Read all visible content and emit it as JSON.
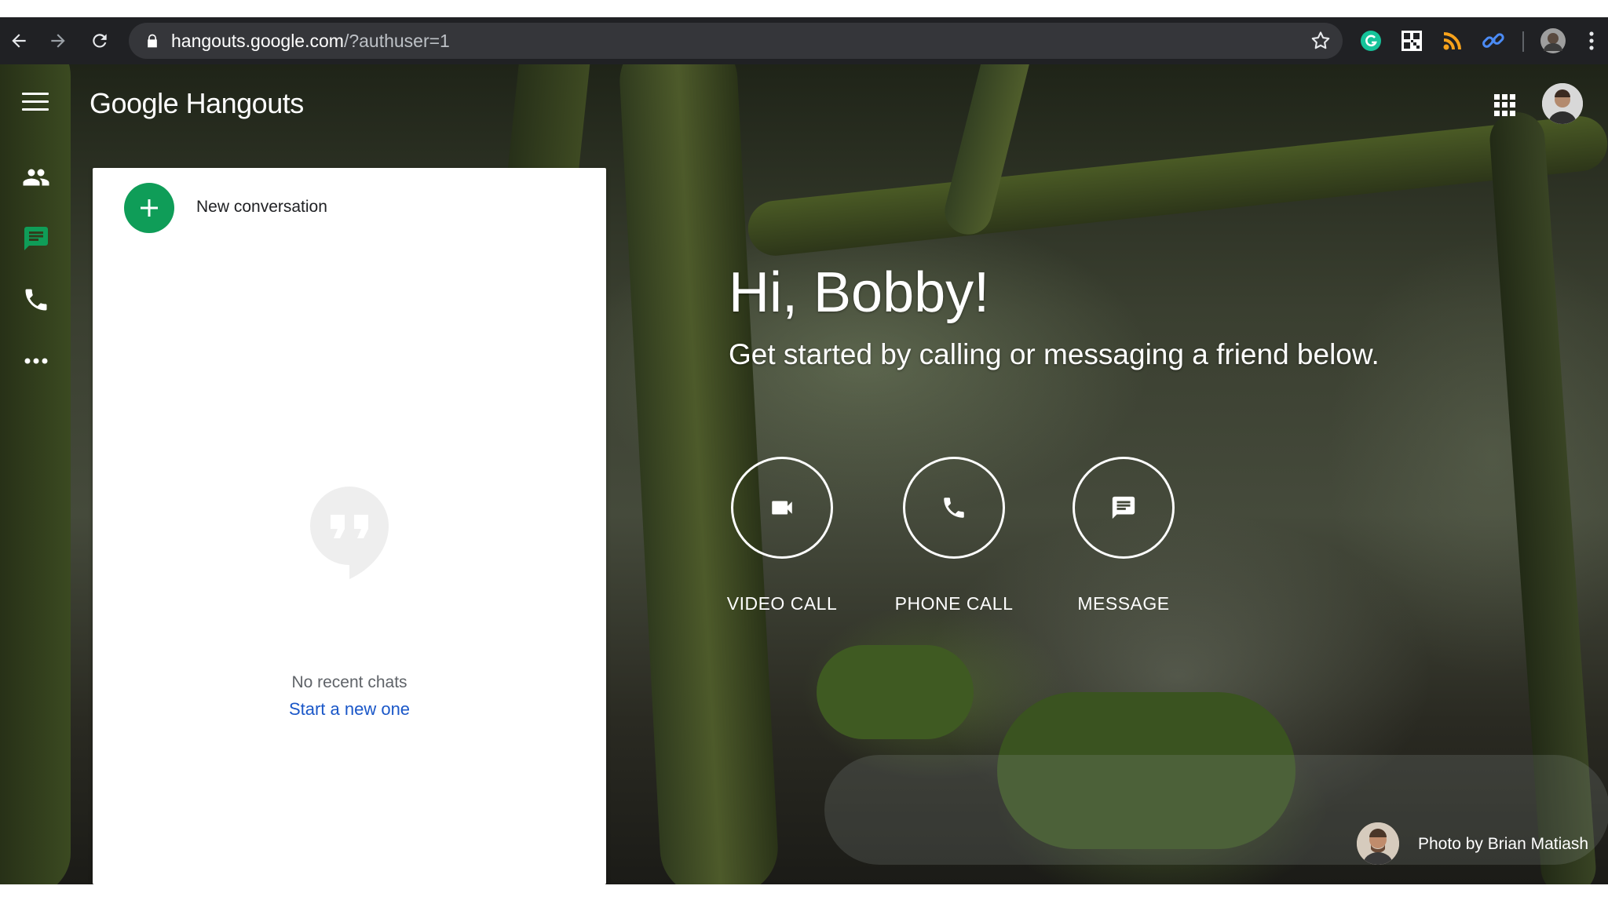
{
  "browser": {
    "url_domain": "hangouts.google.com",
    "url_path": "/?authuser=1",
    "icons": [
      "back-arrow-icon",
      "forward-arrow-icon",
      "reload-icon",
      "lock-icon",
      "bookmark-star-icon",
      "grammarly-extension-icon",
      "qr-extension-icon",
      "rss-extension-icon",
      "link-extension-icon",
      "profile-avatar-icon",
      "menu-kebab-icon"
    ]
  },
  "header": {
    "logo_google": "Google",
    "logo_product": "Hangouts",
    "menu_icon": "hamburger-menu-icon",
    "apps_icon": "apps-grid-icon"
  },
  "sidebar": {
    "items": [
      {
        "name": "contacts",
        "icon": "people-icon",
        "active": false
      },
      {
        "name": "conversations",
        "icon": "chat-icon",
        "active": true
      },
      {
        "name": "phone-calls",
        "icon": "phone-icon",
        "active": false
      },
      {
        "name": "more",
        "icon": "more-horizontal-icon",
        "active": false
      }
    ]
  },
  "panel": {
    "new_conversation": "New conversation",
    "empty_title": "No recent chats",
    "empty_link": "Start a new one"
  },
  "main": {
    "greeting": "Hi, Bobby!",
    "subtitle": "Get started by calling or messaging a friend below.",
    "actions": [
      {
        "label": "VIDEO CALL",
        "icon": "video-camera-icon"
      },
      {
        "label": "PHONE CALL",
        "icon": "phone-icon"
      },
      {
        "label": "MESSAGE",
        "icon": "message-icon"
      }
    ],
    "photo_credit": "Photo by Brian Matiash"
  },
  "colors": {
    "accent_green": "#0f9d58",
    "link_blue": "#1a57c8",
    "browser_bar": "#202124"
  }
}
